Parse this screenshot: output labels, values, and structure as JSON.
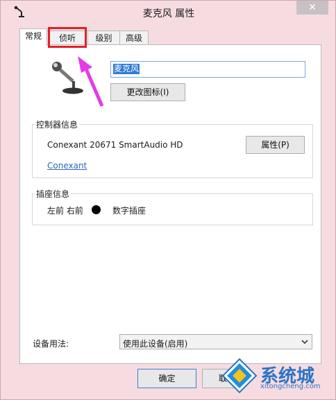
{
  "window": {
    "title": "麦克风 属性",
    "close_label": "✕"
  },
  "tabs": [
    {
      "label": "常规"
    },
    {
      "label": "侦听"
    },
    {
      "label": "级别"
    },
    {
      "label": "高级"
    }
  ],
  "general": {
    "device_name": "麦克风",
    "change_icon_label": "更改图标(I)"
  },
  "controller": {
    "group_label": "控制器信息",
    "name": "Conexant 20671 SmartAudio HD",
    "properties_label": "属性(P)",
    "link_label": "Conexant"
  },
  "jack": {
    "group_label": "插座信息",
    "position": "左前 右前",
    "type": "数字插座"
  },
  "usage": {
    "label": "设备用法:",
    "selected": "使用此设备(启用)"
  },
  "footer": {
    "ok_label": "确定",
    "cancel_label": "取"
  },
  "watermark": {
    "text": "系统城",
    "url": "xitongcheng.com"
  }
}
